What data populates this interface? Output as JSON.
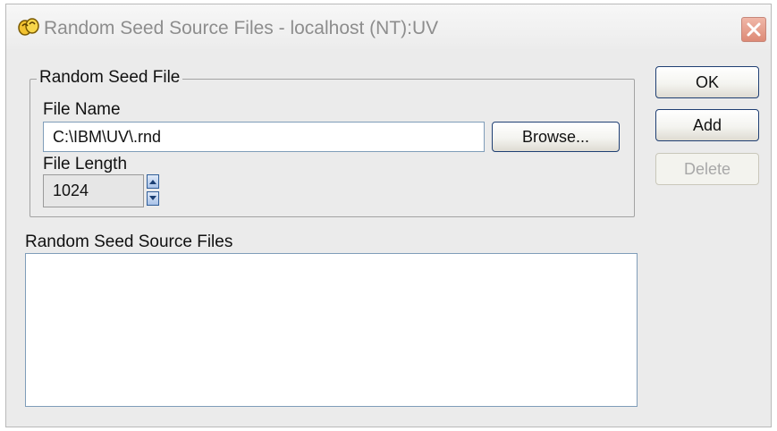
{
  "window": {
    "title": "Random Seed Source Files - localhost (NT):UV"
  },
  "icons": {
    "app": "app-logo-icon",
    "close": "close-icon",
    "spin_up": "spin-up-icon",
    "spin_down": "spin-down-icon"
  },
  "random_seed_file": {
    "group_label": "Random Seed File",
    "file_name_label": "File Name",
    "file_name_value": "C:\\IBM\\UV\\.rnd",
    "browse_label": "Browse...",
    "file_length_label": "File Length",
    "file_length_value": "1024"
  },
  "source_files": {
    "label": "Random Seed Source Files",
    "items": []
  },
  "actions": {
    "ok_label": "OK",
    "add_label": "Add",
    "delete_label": "Delete",
    "delete_enabled": false
  },
  "colors": {
    "window_bg": "#ebebeb",
    "title_text": "#8d8d8d",
    "button_border": "#1f3f73",
    "close_button": "#e39784"
  }
}
